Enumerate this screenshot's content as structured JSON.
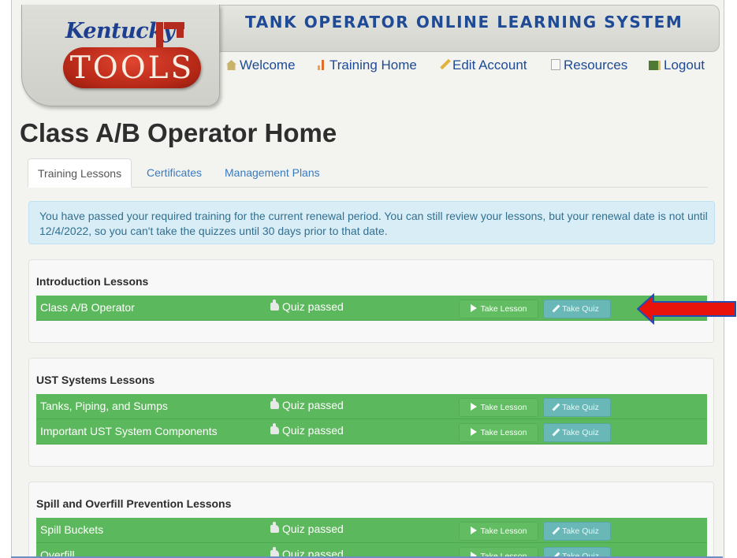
{
  "logo": {
    "top_text": "Kentucky",
    "tank_text": "TOOLS"
  },
  "site_title": "TANK OPERATOR ONLINE LEARNING SYSTEM",
  "nav": [
    {
      "label": "Welcome",
      "icon": "home-icon"
    },
    {
      "label": "Training Home",
      "icon": "bar-chart-icon"
    },
    {
      "label": "Edit Account",
      "icon": "pencil-icon"
    },
    {
      "label": "Resources",
      "icon": "documents-icon"
    },
    {
      "label": "Logout",
      "icon": "logout-icon"
    }
  ],
  "page_title": "Class A/B Operator Home",
  "tabs": [
    {
      "label": "Training Lessons",
      "active": true
    },
    {
      "label": "Certificates",
      "active": false
    },
    {
      "label": "Management Plans",
      "active": false
    }
  ],
  "alert": "You have passed your required training for the current renewal period. You can still review your lessons, but your renewal date is not until 12/4/2022, so you can't take the quizzes until 30 days prior to that date.",
  "buttons": {
    "take_lesson": "Take Lesson",
    "take_quiz": "Take Quiz"
  },
  "sections": [
    {
      "title": "Introduction Lessons",
      "lessons": [
        {
          "name": "Class A/B Operator",
          "status": "Quiz passed"
        }
      ]
    },
    {
      "title": "UST Systems Lessons",
      "lessons": [
        {
          "name": "Tanks, Piping, and Sumps",
          "status": "Quiz passed"
        },
        {
          "name": "Important UST System Components",
          "status": "Quiz passed"
        }
      ]
    },
    {
      "title": "Spill and Overfill Prevention Lessons",
      "lessons": [
        {
          "name": "Spill Buckets",
          "status": "Quiz passed"
        },
        {
          "name": "Overfill",
          "status": "Quiz passed"
        }
      ]
    }
  ],
  "colors": {
    "row_green": "#5cb85c",
    "lesson_button": "#62bc62",
    "quiz_button": "#69b8b7",
    "alert_bg": "#d9edf7",
    "title_blue": "#1e4a96",
    "logo_red": "#b42716",
    "arrow_red": "#e8140c",
    "arrow_outline": "#1f4fb5"
  }
}
